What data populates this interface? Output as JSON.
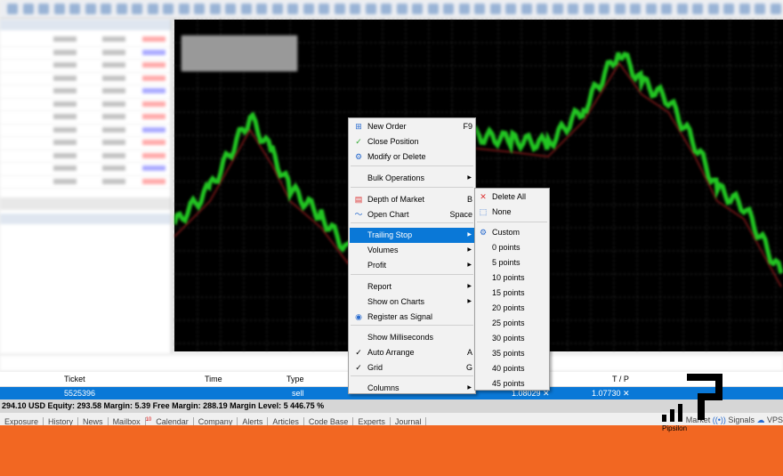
{
  "context_menu": {
    "items": [
      {
        "label": "New Order",
        "shortcut": "F9",
        "icon": "plus-box-icon"
      },
      {
        "label": "Close Position",
        "icon": "check-icon"
      },
      {
        "label": "Modify or Delete",
        "icon": "gear-icon"
      },
      {
        "label": "Bulk Operations",
        "submenu": true
      },
      {
        "label": "Depth of Market",
        "shortcut": "B",
        "icon": "depth-of-market-icon"
      },
      {
        "label": "Open Chart",
        "shortcut": "Space",
        "icon": "line-chart-icon"
      },
      {
        "label": "Trailing Stop",
        "submenu": true,
        "highlighted": true
      },
      {
        "label": "Volumes",
        "submenu": true
      },
      {
        "label": "Profit",
        "submenu": true
      },
      {
        "label": "Report",
        "submenu": true
      },
      {
        "label": "Show on Charts",
        "submenu": true
      },
      {
        "label": "Register as Signal",
        "icon": "signal-icon"
      },
      {
        "label": "Show Milliseconds"
      },
      {
        "label": "Auto Arrange",
        "shortcut": "A",
        "checked": true
      },
      {
        "label": "Grid",
        "shortcut": "G",
        "checked": true
      },
      {
        "label": "Columns",
        "submenu": true
      }
    ]
  },
  "trailing_stop_submenu": {
    "items": [
      "Delete All",
      "None",
      "Custom",
      "0 points",
      "5 points",
      "10 points",
      "15 points",
      "20 points",
      "25 points",
      "30 points",
      "35 points",
      "40 points",
      "45 points"
    ]
  },
  "trade": {
    "headers": {
      "ticket": "Ticket",
      "time": "Time",
      "type": "Type",
      "tp": "T / P"
    },
    "row": {
      "ticket": "5525396",
      "type": "sell",
      "sl": "1.08029",
      "tp": "1.07730"
    },
    "status": "294.10 USD  Equity: 293.58  Margin: 5.39  Free Margin: 288.19  Margin Level: 5 446.75 %"
  },
  "bottom_tabs": [
    "Exposure",
    "History",
    "News",
    "Mailbox",
    "Calendar",
    "Company",
    "Alerts",
    "Articles",
    "Code Base",
    "Experts",
    "Journal"
  ],
  "mailbox_badge": "10",
  "right_tabs": {
    "market": "Market",
    "signals": "Signals",
    "vps": "VPS"
  },
  "logo": {
    "text": "Pipsilon"
  },
  "colors": {
    "highlight": "#0a78d7",
    "orange": "#f26722",
    "chart_bg": "#000000",
    "candles": "#22c522"
  }
}
